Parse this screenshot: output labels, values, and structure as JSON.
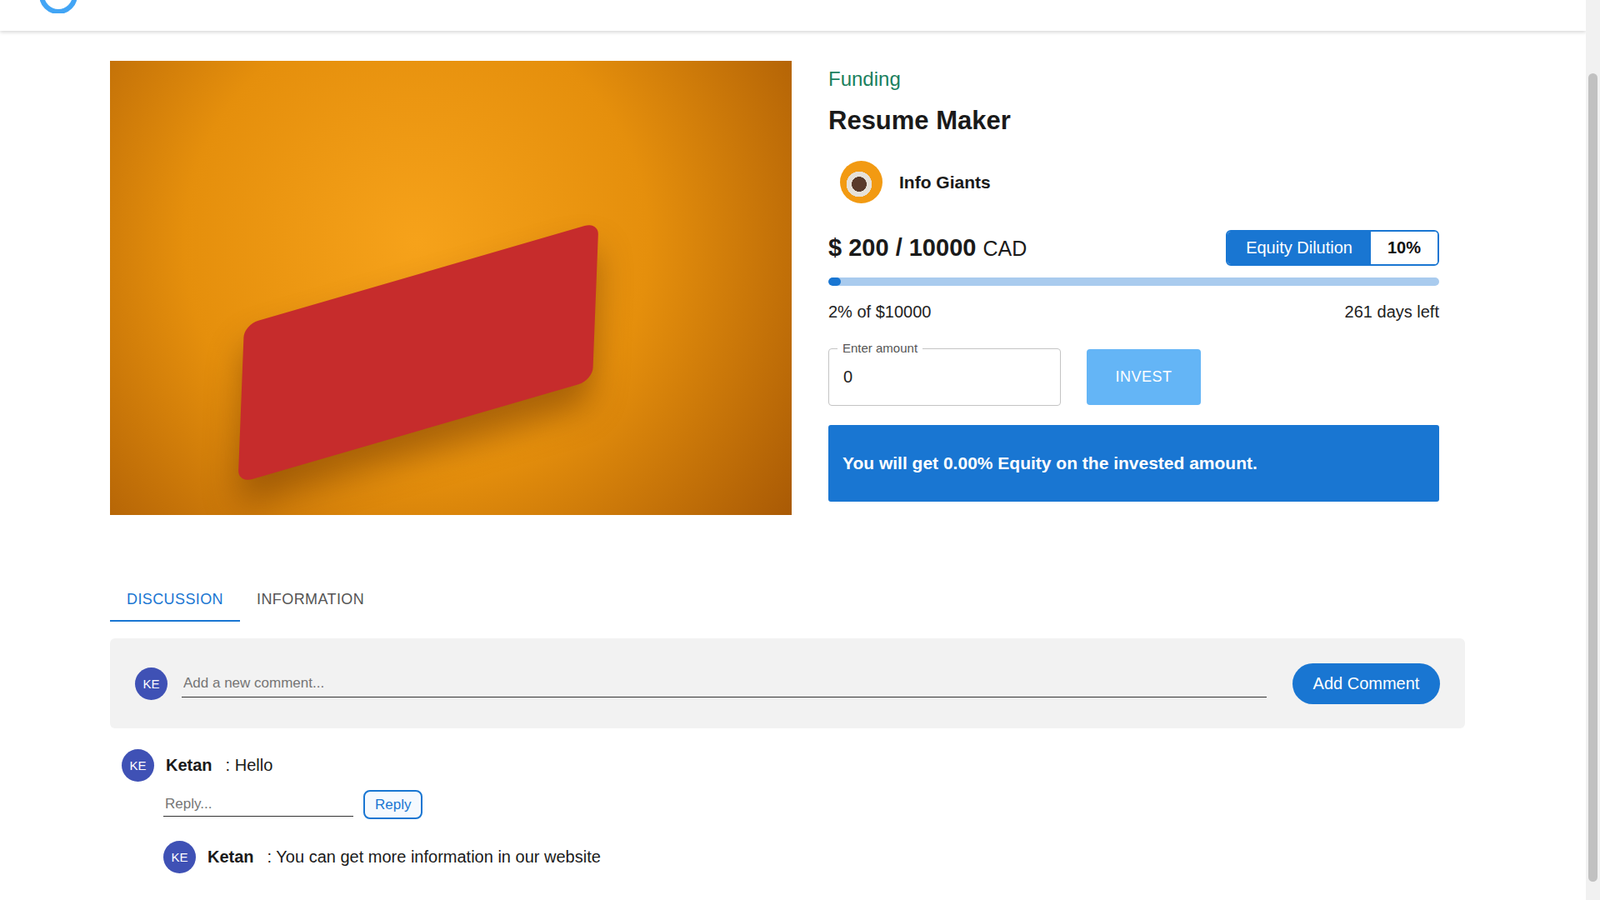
{
  "project": {
    "status": "Funding",
    "title": "Resume Maker",
    "owner": "Info Giants",
    "raised": "$ 200 / 10000",
    "currency": "CAD",
    "equity_label": "Equity Dilution",
    "equity_value": "10%",
    "level": 0.02,
    "progress_text": "2% of $10000",
    "days_left": "261 days left"
  },
  "invest": {
    "label": "Enter amount",
    "value": "0",
    "button": "INVEST",
    "disabled": true,
    "note": "You will get 0.00% Equity on the invested amount."
  },
  "tabs": [
    {
      "label": "DISCUSSION",
      "selected": true
    },
    {
      "label": "INFORMATION",
      "selected": false
    }
  ],
  "comment_box": {
    "avatar": "KE",
    "placeholder": "Add a new comment...",
    "button": "Add Comment"
  },
  "comments": [
    {
      "avatar": "KE",
      "author": "Ketan",
      "text": ": Hello",
      "reply_placeholder": "Reply...",
      "reply_button": "Reply",
      "replies": [
        {
          "avatar": "KE",
          "author": "Ketan",
          "text": ": You can get more information in our website"
        }
      ]
    }
  ]
}
